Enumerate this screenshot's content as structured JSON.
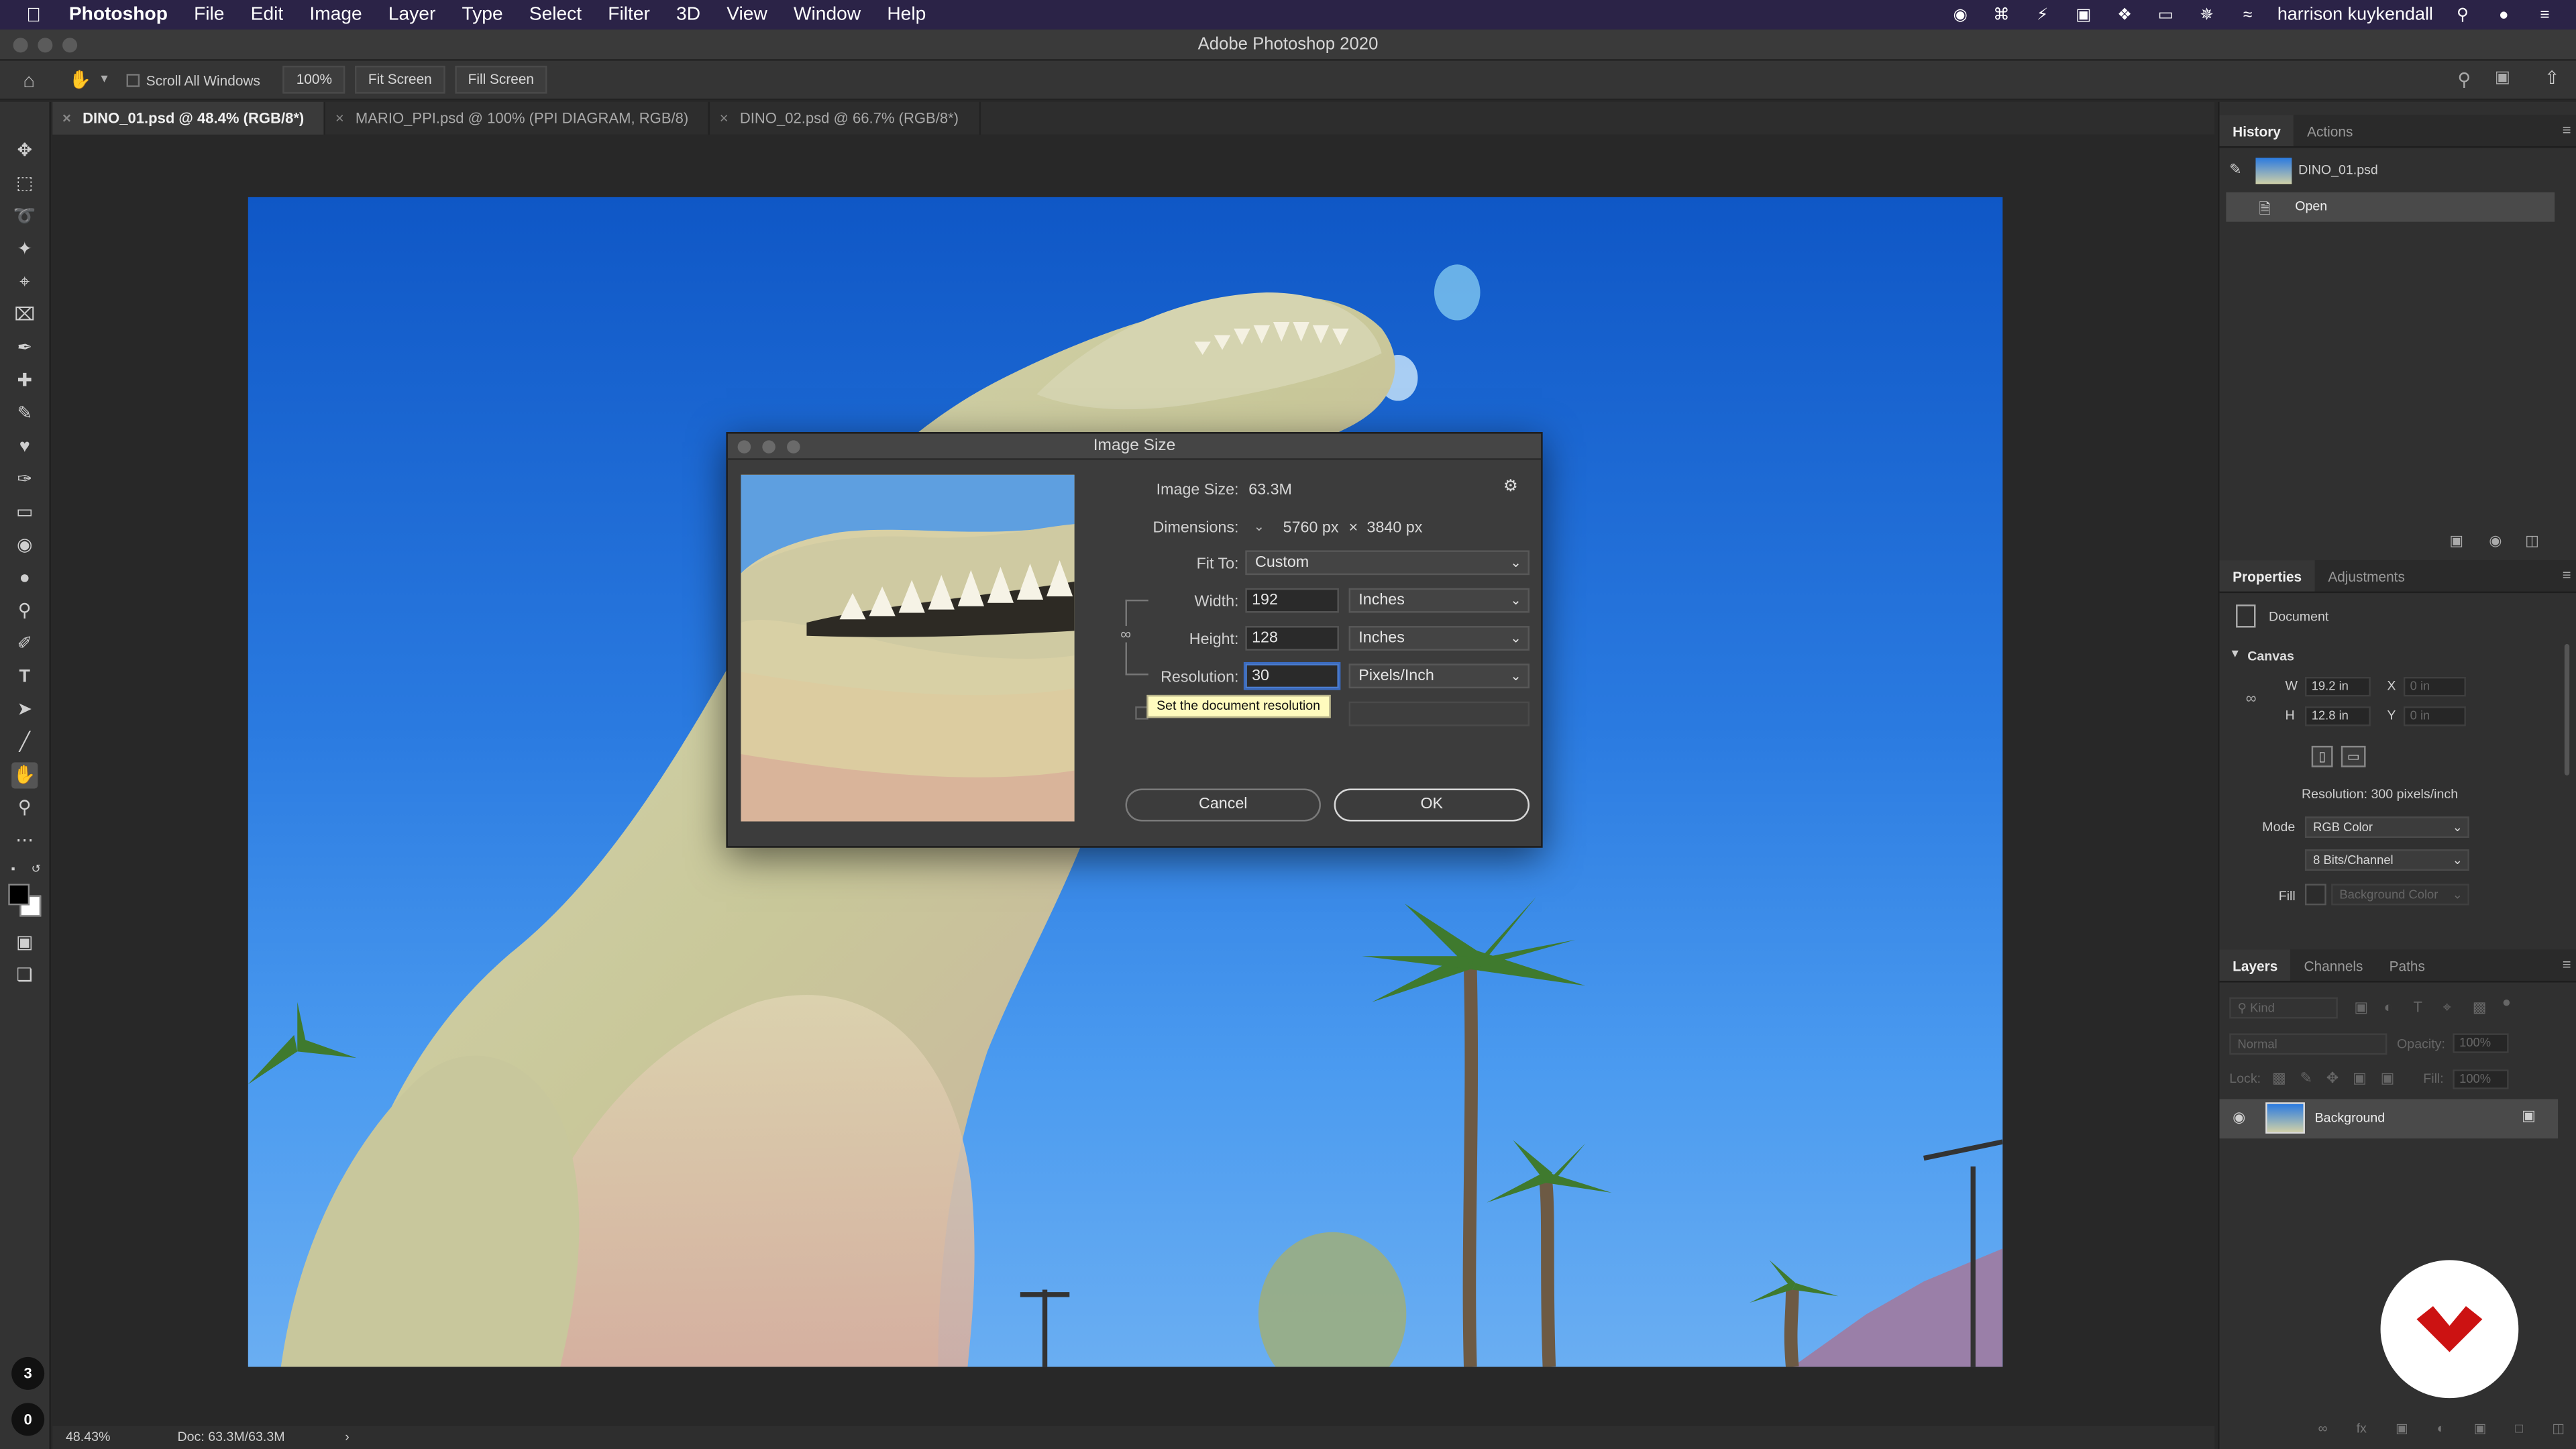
{
  "menubar": {
    "app_name": "Photoshop",
    "items": [
      "File",
      "Edit",
      "Image",
      "Layer",
      "Type",
      "Select",
      "Filter",
      "3D",
      "View",
      "Window",
      "Help"
    ],
    "user": "harrison kuykendall"
  },
  "window": {
    "title": "Adobe Photoshop 2020"
  },
  "options_bar": {
    "scroll_all_windows": "Scroll All Windows",
    "zoom_100": "100%",
    "fit_screen": "Fit Screen",
    "fill_screen": "Fill Screen"
  },
  "tabs": [
    {
      "label": "DINO_01.psd @ 48.4% (RGB/8*)",
      "active": true
    },
    {
      "label": "MARIO_PPI.psd @ 100% (PPI DIAGRAM, RGB/8)",
      "active": false
    },
    {
      "label": "DINO_02.psd @ 66.7% (RGB/8*)",
      "active": false
    }
  ],
  "status": {
    "zoom": "48.43%",
    "doc": "Doc: 63.3M/63.3M"
  },
  "history_panel": {
    "tabs": [
      "History",
      "Actions"
    ],
    "snapshot": "DINO_01.psd",
    "steps": [
      "Open"
    ]
  },
  "properties_panel": {
    "tabs": [
      "Properties",
      "Adjustments"
    ],
    "document_label": "Document",
    "canvas_label": "Canvas",
    "w_label": "W",
    "w_value": "19.2 in",
    "h_label": "H",
    "h_value": "12.8 in",
    "x_label": "X",
    "x_value": "0 in",
    "y_label": "Y",
    "y_value": "0 in",
    "resolution": "Resolution: 300 pixels/inch",
    "mode_label": "Mode",
    "mode_value": "RGB Color",
    "bits_value": "8 Bits/Channel",
    "fill_label": "Fill",
    "fill_value": "Background Color"
  },
  "layers_panel": {
    "tabs": [
      "Layers",
      "Channels",
      "Paths"
    ],
    "kind": "Kind",
    "blend": "Normal",
    "opacity_label": "Opacity:",
    "opacity_value": "100%",
    "lock_label": "Lock:",
    "fill_label": "Fill:",
    "fill_value": "100%",
    "layer_name": "Background"
  },
  "dialog": {
    "title": "Image Size",
    "image_size_label": "Image Size:",
    "image_size_value": "63.3M",
    "dimensions_label": "Dimensions:",
    "dim_w": "5760 px",
    "dim_x": "×",
    "dim_h": "3840 px",
    "fit_to_label": "Fit To:",
    "fit_to_value": "Custom",
    "width_label": "Width:",
    "width_value": "192",
    "width_unit": "Inches",
    "height_label": "Height:",
    "height_value": "128",
    "height_unit": "Inches",
    "resolution_label": "Resolution:",
    "resolution_value": "30",
    "resolution_unit": "Pixels/Inch",
    "tooltip": "Set the document resolution",
    "cancel": "Cancel",
    "ok": "OK"
  },
  "badges": {
    "b1": "3",
    "b2": "0"
  },
  "colors": {
    "accent_logo": "#cc1212",
    "menubar": "#2b2347",
    "sky": "#2a7ae0"
  }
}
